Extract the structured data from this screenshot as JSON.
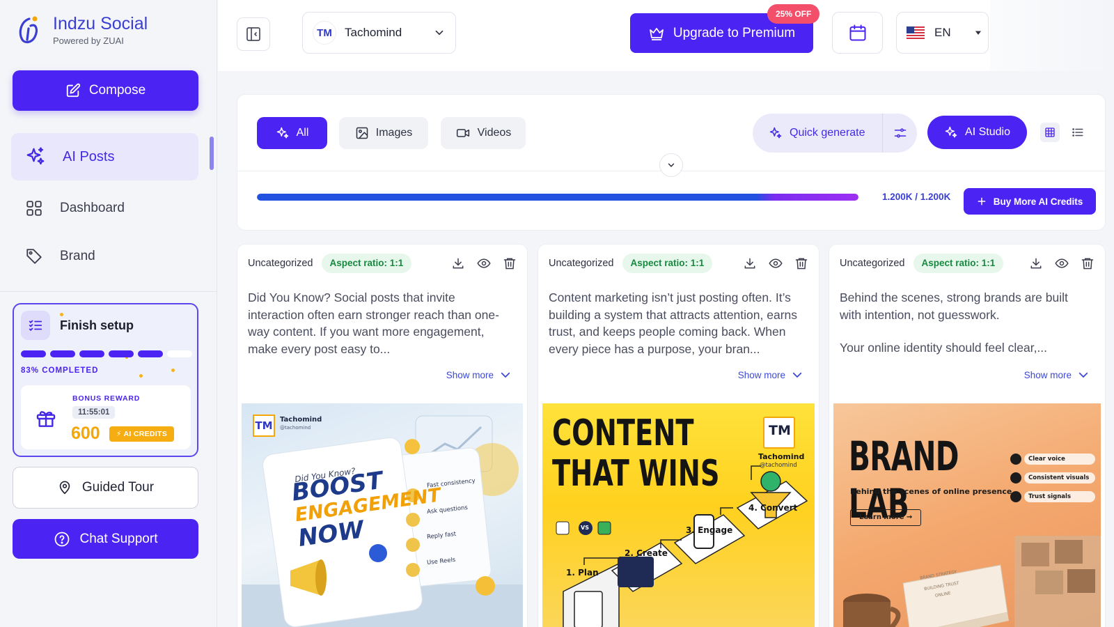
{
  "brand": {
    "name": "Indzu Social",
    "subtitle": "Powered by ZUAI"
  },
  "sidebar": {
    "compose_label": "Compose",
    "items": [
      {
        "label": "AI Posts",
        "icon": "sparkles-icon",
        "active": true
      },
      {
        "label": "Dashboard",
        "icon": "grid-icon",
        "active": false
      },
      {
        "label": "Brand",
        "icon": "tag-icon",
        "active": false
      }
    ],
    "setup": {
      "title": "Finish setup",
      "completed_label": "83% COMPLETED",
      "progress": 0.83,
      "bonus_label": "BONUS REWARD",
      "timer": "11:55:01",
      "amount": "600",
      "credits_label": "AI CREDITS"
    },
    "guided_tour_label": "Guided Tour",
    "chat_support_label": "Chat Support"
  },
  "header": {
    "workspace": {
      "initials": "TM",
      "name": "Tachomind"
    },
    "upgrade_label": "Upgrade to Premium",
    "discount_badge": "25% OFF",
    "language": "EN"
  },
  "toolbar": {
    "tabs": [
      {
        "label": "All",
        "icon": "sparkles-icon",
        "active": true
      },
      {
        "label": "Images",
        "icon": "image-icon",
        "active": false
      },
      {
        "label": "Videos",
        "icon": "video-icon",
        "active": false
      }
    ],
    "quick_generate_label": "Quick generate",
    "ai_studio_label": "AI Studio",
    "credits_text": "1.200K / 1.200K",
    "credits_fraction": 1.0,
    "buy_credits_label": "Buy More AI Credits"
  },
  "posts": [
    {
      "category": "Uncategorized",
      "aspect": "Aspect ratio: 1:1",
      "text": "Did You Know? Social posts that invite interaction often earn stronger reach than one-way content. If you want more engagement, make every post easy to...",
      "show_more": "Show more",
      "image": {
        "brand_initials": "TM",
        "brand_name": "Tachomind",
        "handle": "@tachomind",
        "kicker": "Did You Know?",
        "headline": [
          "BOOST",
          "ENGAGEMENT",
          "NOW"
        ],
        "tips": [
          "Fast consistency",
          "Ask questions",
          "Reply fast",
          "Use Reels"
        ]
      }
    },
    {
      "category": "Uncategorized",
      "aspect": "Aspect ratio: 1:1",
      "text": "Content marketing isn’t just posting often. It’s building a system that attracts attention, earns trust, and keeps people coming back. When every piece has a purpose, your bran...",
      "show_more": "Show more",
      "image": {
        "headline": [
          "CONTENT",
          "THAT WINS"
        ],
        "brand_initials": "TM",
        "brand_name": "Tachomind",
        "handle": "@tachomind",
        "vs": "VS",
        "steps": [
          "1. Plan",
          "2. Create",
          "3. Engage",
          "4. Convert"
        ]
      }
    },
    {
      "category": "Uncategorized",
      "aspect": "Aspect ratio: 1:1",
      "text": "Behind the scenes, strong brands are built with intention, not guesswork.",
      "text2": "Your online identity should feel clear,...",
      "show_more": "Show more",
      "image": {
        "headline": "BRAND LAB",
        "subhead": "Behind the scenes of online presence",
        "cta": "Learn more",
        "points": [
          "Clear voice",
          "Consistent visuals",
          "Trust signals"
        ],
        "book_text": [
          "BRAND STRATEGY",
          "BUILDING TRUST",
          "ONLINE"
        ]
      }
    }
  ]
}
